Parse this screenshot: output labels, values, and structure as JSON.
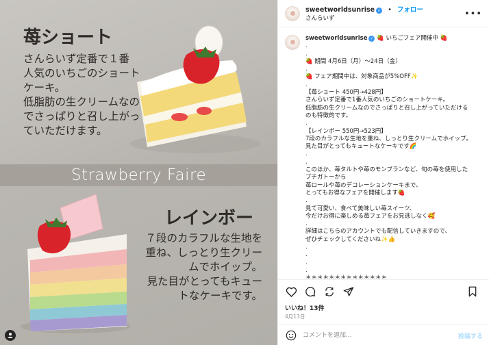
{
  "media": {
    "top_title": "苺ショート",
    "top_desc": [
      "さんらいず定番で１番",
      "人気のいちごのショート",
      "ケーキ。",
      "低脂肪の生クリームなの",
      "でさっぱりと召し上がっ",
      "ていただけます。"
    ],
    "band_text": "Strawberry Faire",
    "bottom_title": "レインボー",
    "bottom_desc": [
      "７段のカラフルな生地を",
      "重ね、しっとり生クリー",
      "ムでホイップ。",
      "見た目がとってもキュー",
      "トなケーキです。"
    ]
  },
  "header": {
    "username": "sweetworldsunrise",
    "separator": "•",
    "follow_label": "フォロー",
    "location": "さんらいず",
    "more_icon": "more-horizontal-icon"
  },
  "caption": {
    "username": "sweetworldsunrise",
    "first_line": " 🍓 いちごフェア開催中 🍓",
    "lines": [
      ".",
      ".",
      "🍓 期間 4月6日（月）〜24日（金）",
      ".",
      "🍓 フェア期間中は、対象商品が5%OFF✨",
      ".",
      "【苺ショート 450円→428円】",
      "さんらいず定番で1番人気のいちごのショートケーキ。",
      "低脂肪の生クリームなのでさっぱりと召し上がっていただける",
      "のも特徴的です。",
      ".",
      "【レインボー 550円→523円】",
      "7段のカラフルな生地を重ね、しっとり生クリームでホイップ。",
      "見た目がとってもキュートなケーキです🌈",
      ".",
      ".",
      "このほか、苺タルトや苺のモンブランなど、旬の苺を使用した",
      "プチガトーから",
      "苺ロールや苺のデコレーションケーキまで、",
      "とってもお得なフェアを開催します🍓",
      ".",
      "見て可愛い、食べて美味しい苺スイーツ、",
      "今だけお得に楽しめる苺フェアをお見逃しなく🥰",
      ".",
      "詳細はこちらのアカウントでも配信していきますので、",
      "ぜひチェックしてくださいね✨👍",
      ".",
      ".",
      ".",
      ".",
      "＊＊＊＊＊＊＊＊＊＊＊＊＊＊"
    ]
  },
  "actions": {
    "like_icon": "heart-icon",
    "comment_icon": "comment-icon",
    "repost_icon": "repost-icon",
    "share_icon": "share-icon",
    "save_icon": "bookmark-icon"
  },
  "likes": "いいね！13件",
  "date": "4月13日",
  "comment": {
    "placeholder": "コメントを追加...",
    "post_label": "投稿する",
    "emoji_icon": "emoji-icon"
  },
  "colors": {
    "accent": "#0095f6",
    "verified": "#3897f0",
    "band": "#a5a09a"
  }
}
